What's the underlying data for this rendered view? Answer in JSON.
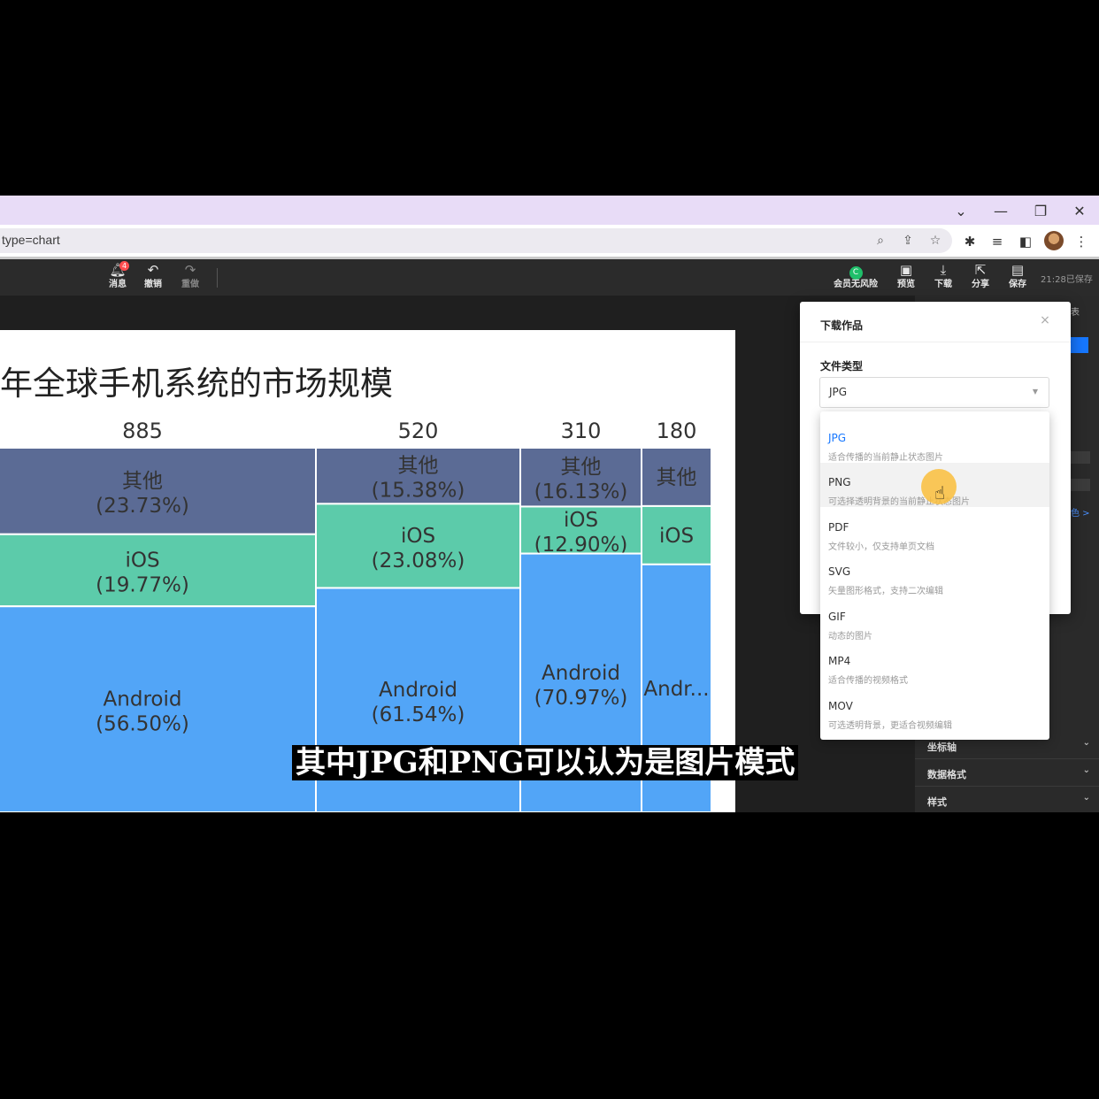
{
  "browser": {
    "url": "type=chart"
  },
  "toolbar": {
    "message_label": "消息",
    "message_badge": "4",
    "undo_label": "撤销",
    "redo_label": "重做",
    "vip_label": "会员无风险",
    "vip_badge": "C",
    "preview_label": "预览",
    "download_label": "下载",
    "share_label": "分享",
    "save_label": "保存",
    "saved_status": "21:28已保存"
  },
  "chart_data": {
    "type": "mekko",
    "title": "年全球手机系统的市场规模",
    "columns": [
      {
        "total": "885",
        "total_value": 885,
        "segments": [
          {
            "name": "其他",
            "pct": 23.73,
            "label": "(23.73%)"
          },
          {
            "name": "iOS",
            "pct": 19.77,
            "label": "(19.77%)"
          },
          {
            "name": "Android",
            "pct": 56.5,
            "label": "(56.50%)"
          }
        ]
      },
      {
        "total": "520",
        "total_value": 520,
        "segments": [
          {
            "name": "其他",
            "pct": 15.38,
            "label": "(15.38%)"
          },
          {
            "name": "iOS",
            "pct": 23.08,
            "label": "(23.08%)"
          },
          {
            "name": "Android",
            "pct": 61.54,
            "label": "(61.54%)"
          }
        ]
      },
      {
        "total": "310",
        "total_value": 310,
        "segments": [
          {
            "name": "其他",
            "pct": 16.13,
            "label": "(16.13%)"
          },
          {
            "name": "iOS",
            "pct": 12.9,
            "label": "(12.90%)"
          },
          {
            "name": "Android",
            "pct": 70.97,
            "label": "(70.97%)"
          }
        ]
      },
      {
        "total": "180",
        "total_value": 180,
        "segments": [
          {
            "name": "其他",
            "pct": 16.0,
            "label": ""
          },
          {
            "name": "iOS",
            "pct": 16.0,
            "label": ""
          },
          {
            "name": "Andr...",
            "pct": 68.0,
            "label": ""
          }
        ]
      }
    ],
    "colors": {
      "其他": "#5b6b95",
      "iOS": "#5ccbaa",
      "Android": "#52a5f7"
    }
  },
  "panel": {
    "rows": [
      "坐标轴",
      "数据格式",
      "样式"
    ],
    "link_text": "色 >",
    "tab_text": "表"
  },
  "dialog": {
    "title": "下载作品",
    "filetype_label": "文件类型",
    "filetype_value": "JPG",
    "options": [
      {
        "name": "JPG",
        "desc": "适合传播的当前静止状态图片"
      },
      {
        "name": "PNG",
        "desc": "可选择透明背景的当前静止状态图片"
      },
      {
        "name": "PDF",
        "desc": "文件较小，仅支持单页文档"
      },
      {
        "name": "SVG",
        "desc": "矢量图形格式，支持二次编辑"
      },
      {
        "name": "GIF",
        "desc": "动态的图片"
      },
      {
        "name": "MP4",
        "desc": "适合传播的视频格式"
      },
      {
        "name": "MOV",
        "desc": "可选透明背景，更适合视频编辑"
      }
    ]
  },
  "subtitle": "其中JPG和PNG可以认为是图片模式"
}
